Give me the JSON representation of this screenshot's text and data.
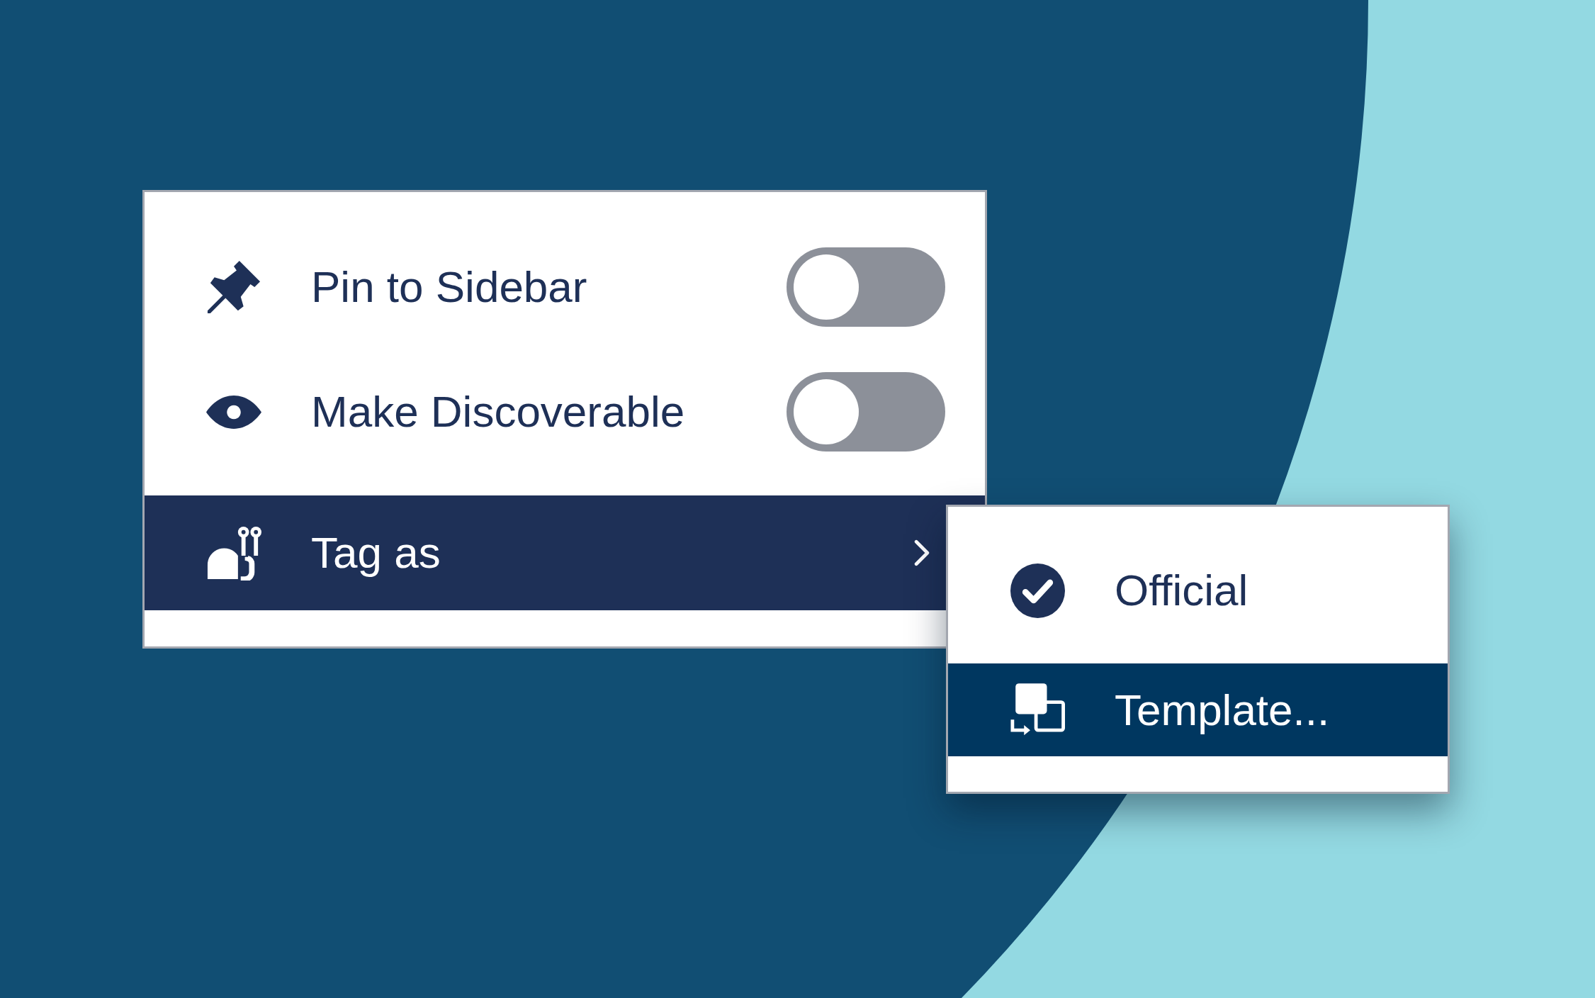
{
  "menu": {
    "items": [
      {
        "kind": "toggle",
        "label": "Pin to Sidebar",
        "on": false
      },
      {
        "kind": "toggle",
        "label": "Make Discoverable",
        "on": false
      },
      {
        "kind": "submenu",
        "label": "Tag as",
        "expanded": true
      }
    ]
  },
  "submenu": {
    "items": [
      {
        "label": "Official",
        "selected": false
      },
      {
        "label": "Template...",
        "selected": true
      }
    ]
  }
}
